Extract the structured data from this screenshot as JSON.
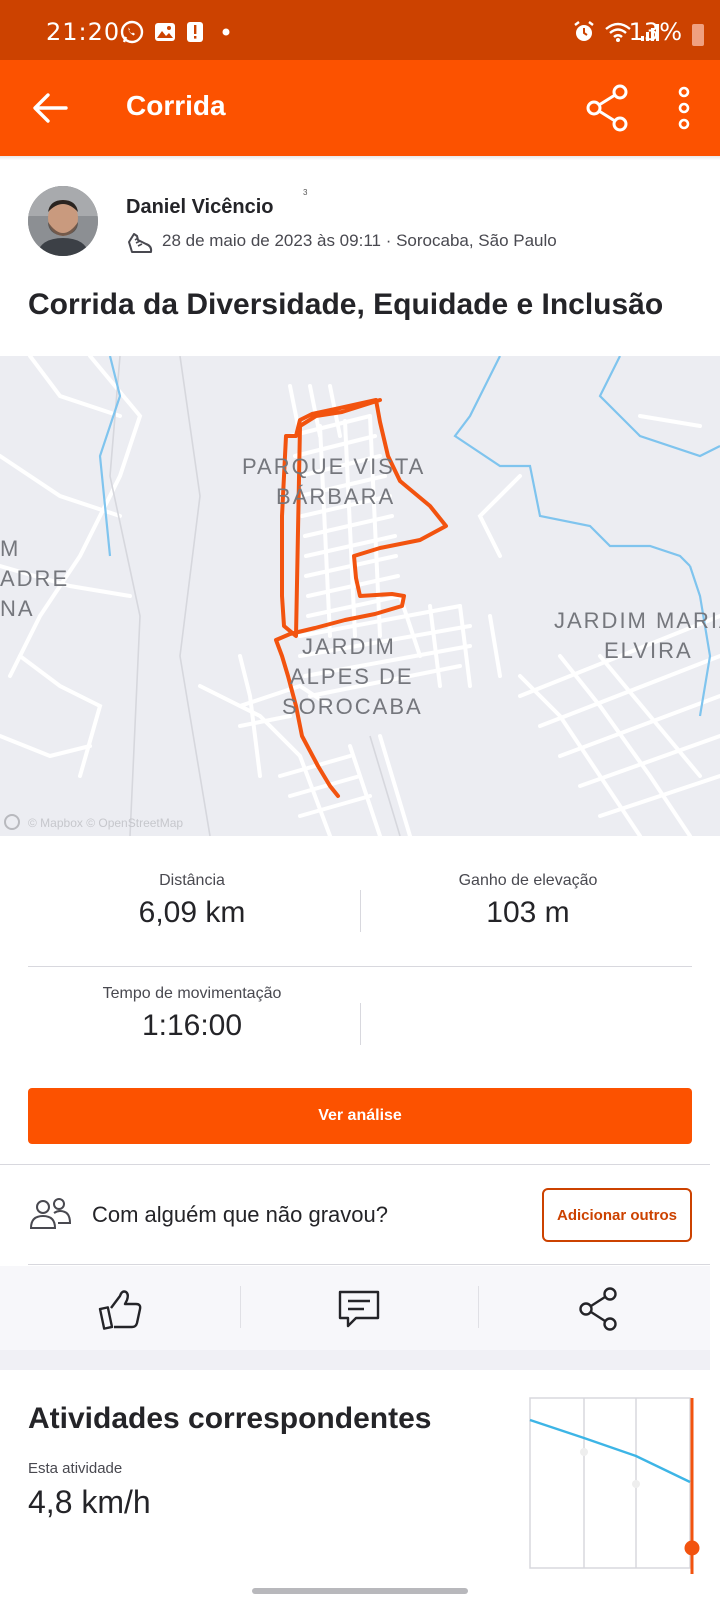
{
  "status_bar": {
    "time": "21:20",
    "battery": "13%",
    "left_icons": [
      "whatsapp-icon",
      "gallery-icon",
      "alert-icon",
      "dot-icon"
    ],
    "right_icons": [
      "alarm-icon",
      "wifi-icon",
      "signal-icon",
      "battery-icon"
    ]
  },
  "app_bar": {
    "title": "Corrida",
    "back_icon": "arrow-left-icon",
    "share_icon": "share-icon",
    "more_icon": "more-vertical-icon"
  },
  "header": {
    "author": "Daniel Vicêncio",
    "superscript": "3",
    "meta": "28 de maio de 2023 às 09:11 · Sorocaba, São Paulo",
    "activity_title": "Corrida da Diversidade, Equidade e Inclusão"
  },
  "map": {
    "labels": [
      "PARQUE VISTA",
      "BÁRBARA",
      "JARDIM",
      "ALPES DE",
      "SOROCABA",
      "JARDIM MARIA",
      "ELVIRA",
      "M",
      "ADRE",
      "NA"
    ],
    "attribution": "© Mapbox © OpenStreetMap"
  },
  "stats": {
    "distance_label": "Distância",
    "distance_value": "6,09 km",
    "elevation_label": "Ganho de elevação",
    "elevation_value": "103 m",
    "moving_time_label": "Tempo de movimentação",
    "moving_time_value": "1:16:00"
  },
  "analysis_button": "Ver análise",
  "with_others": {
    "text": "Com alguém que não gravou?",
    "button": "Adicionar outros"
  },
  "actions": {
    "kudos_icon": "thumbs-up-icon",
    "comment_icon": "comment-icon",
    "share_icon": "share-icon"
  },
  "matched": {
    "title": "Atividades correspondentes",
    "this_activity_label": "Esta atividade",
    "speed": "4,8 km/h"
  },
  "colors": {
    "brand": "#fc5200",
    "status_bar": "#cc4200",
    "route": "#f2530f",
    "chart_line": "#3db5e6"
  }
}
